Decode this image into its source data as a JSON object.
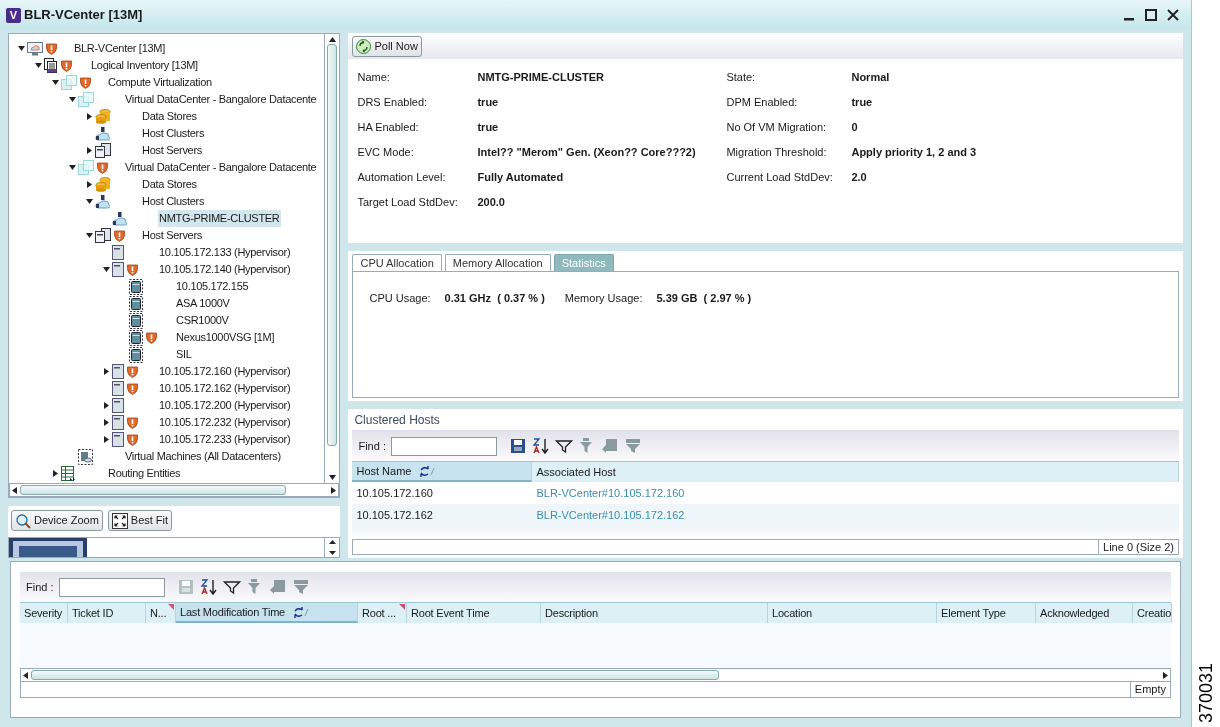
{
  "window": {
    "logo_letter": "V",
    "title": "BLR-VCenter [13M]"
  },
  "tree": [
    {
      "label": "BLR-VCenter [13M]",
      "kind": "vcenter",
      "alert": true,
      "expanded": true,
      "selected": false,
      "children": [
        {
          "label": "Logical Inventory [13M]",
          "kind": "inventory",
          "alert": true,
          "expanded": true,
          "selected": false,
          "children": [
            {
              "label": "Compute Virtualization",
              "kind": "compute",
              "alert": true,
              "expanded": true,
              "selected": false,
              "children": [
                {
                  "label": "Virtual DataCenter - Bangalore Datacente",
                  "kind": "compute",
                  "alert": false,
                  "expanded": true,
                  "selected": false,
                  "children": [
                    {
                      "label": "Data Stores",
                      "kind": "datastore",
                      "alert": false,
                      "expanded": false,
                      "selected": false
                    },
                    {
                      "label": "Host Clusters",
                      "kind": "cluster",
                      "alert": false,
                      "selected": false
                    },
                    {
                      "label": "Host Servers",
                      "kind": "servers",
                      "alert": false,
                      "expanded": false,
                      "selected": false
                    }
                  ]
                },
                {
                  "label": "Virtual DataCenter - Bangalore Datacente",
                  "kind": "compute",
                  "alert": true,
                  "expanded": true,
                  "selected": false,
                  "children": [
                    {
                      "label": "Data Stores",
                      "kind": "datastore",
                      "alert": false,
                      "expanded": false,
                      "selected": false
                    },
                    {
                      "label": "Host Clusters",
                      "kind": "cluster",
                      "alert": false,
                      "expanded": true,
                      "selected": false,
                      "children": [
                        {
                          "label": "NMTG-PRIME-CLUSTER",
                          "kind": "cluster",
                          "alert": false,
                          "selected": true
                        }
                      ]
                    },
                    {
                      "label": "Host Servers",
                      "kind": "servers",
                      "alert": true,
                      "expanded": true,
                      "selected": false,
                      "children": [
                        {
                          "label": "10.105.172.133 (Hypervisor)",
                          "kind": "server",
                          "alert": false,
                          "selected": false
                        },
                        {
                          "label": "10.105.172.140 (Hypervisor)",
                          "kind": "server",
                          "alert": true,
                          "expanded": true,
                          "selected": false,
                          "children": [
                            {
                              "label": "10.105.172.155",
                              "kind": "vm",
                              "alert": false,
                              "selected": false
                            },
                            {
                              "label": "ASA 1000V",
                              "kind": "vm",
                              "alert": false,
                              "selected": false
                            },
                            {
                              "label": "CSR1000V",
                              "kind": "vm",
                              "alert": false,
                              "selected": false
                            },
                            {
                              "label": "Nexus1000VSG [1M]",
                              "kind": "vm",
                              "alert": true,
                              "selected": false
                            },
                            {
                              "label": "SIL",
                              "kind": "vm",
                              "alert": false,
                              "selected": false
                            }
                          ]
                        },
                        {
                          "label": "10.105.172.160 (Hypervisor)",
                          "kind": "server",
                          "alert": true,
                          "expanded": false,
                          "selected": false
                        },
                        {
                          "label": "10.105.172.162 (Hypervisor)",
                          "kind": "server",
                          "alert": true,
                          "selected": false
                        },
                        {
                          "label": "10.105.172.200 (Hypervisor)",
                          "kind": "server",
                          "alert": false,
                          "expanded": false,
                          "selected": false
                        },
                        {
                          "label": "10.105.172.232 (Hypervisor)",
                          "kind": "server",
                          "alert": true,
                          "expanded": false,
                          "selected": false
                        },
                        {
                          "label": "10.105.172.233 (Hypervisor)",
                          "kind": "server",
                          "alert": true,
                          "expanded": false,
                          "selected": false
                        }
                      ]
                    }
                  ]
                },
                {
                  "label": "Virtual Machines (All Datacenters)",
                  "kind": "vms",
                  "alert": false,
                  "selected": false
                }
              ]
            },
            {
              "label": "Routing Entities",
              "kind": "routing",
              "alert": false,
              "expanded": false,
              "selected": false
            }
          ]
        }
      ]
    }
  ],
  "zoom_buttons": [
    {
      "label": "Device Zoom",
      "kind": "zoom"
    },
    {
      "label": "Best Fit",
      "kind": "fit"
    }
  ],
  "poll_button": "Poll Now",
  "properties_left": [
    {
      "label": "Name:",
      "value": "NMTG-PRIME-CLUSTER"
    },
    {
      "label": "DRS Enabled:",
      "value": "true"
    },
    {
      "label": "HA Enabled:",
      "value": "true"
    },
    {
      "label": "EVC Mode:",
      "value": "Intel?? \"Merom\" Gen. (Xeon?? Core???2)"
    },
    {
      "label": "Automation Level:",
      "value": "Fully Automated"
    },
    {
      "label": "Target Load StdDev:",
      "value": "200.0"
    }
  ],
  "properties_right": [
    {
      "label": "State:",
      "value": "Normal"
    },
    {
      "label": "DPM Enabled:",
      "value": "true"
    },
    {
      "label": "No Of VM Migration:",
      "value": "0"
    },
    {
      "label": "Migration Threshold:",
      "value": "Apply priority 1, 2 and 3"
    },
    {
      "label": "Current Load StdDev:",
      "value": "2.0"
    }
  ],
  "tabs": [
    {
      "label": "CPU Allocation",
      "selected": false
    },
    {
      "label": "Memory Allocation",
      "selected": false
    },
    {
      "label": "Statistics",
      "selected": true
    }
  ],
  "statistics": [
    {
      "label": "CPU Usage:",
      "value": "0.31 GHz  ( 0.37 % )"
    },
    {
      "label": "Memory Usage:",
      "value": "5.39 GB  ( 2.97 % )"
    }
  ],
  "clustered_hosts": {
    "title": "Clustered Hosts",
    "find_label": "Find :",
    "toolbar": [
      {
        "kind": "save",
        "disabled": false
      },
      {
        "kind": "sort",
        "disabled": false
      },
      {
        "kind": "filter",
        "disabled": false
      },
      {
        "kind": "clear-filter",
        "disabled": true
      },
      {
        "kind": "back",
        "disabled": true
      },
      {
        "kind": "edit-filter",
        "disabled": true
      }
    ],
    "columns": [
      {
        "label": "Host Name",
        "sorted": true,
        "marked": false
      },
      {
        "label": "Associated Host",
        "sorted": false,
        "marked": false
      }
    ],
    "rows": [
      [
        "10.105.172.160",
        "BLR-VCenter#10.105.172.160"
      ],
      [
        "10.105.172.162",
        "BLR-VCenter#10.105.172.162"
      ]
    ],
    "status": "Line 0 (Size 2)"
  },
  "tickets": {
    "find_label": "Find :",
    "toolbar": [
      {
        "kind": "save",
        "disabled": true
      },
      {
        "kind": "sort",
        "disabled": false
      },
      {
        "kind": "filter",
        "disabled": false
      },
      {
        "kind": "clear-filter",
        "disabled": true
      },
      {
        "kind": "back",
        "disabled": true
      },
      {
        "kind": "edit-filter",
        "disabled": true
      }
    ],
    "columns": [
      {
        "label": "Severity",
        "sorted": false,
        "marked": false
      },
      {
        "label": "Ticket ID",
        "sorted": false,
        "marked": false
      },
      {
        "label": "N...",
        "sorted": false,
        "marked": true
      },
      {
        "label": "Last Modification Time",
        "sorted": true,
        "marked": false
      },
      {
        "label": "Root ...",
        "sorted": false,
        "marked": true
      },
      {
        "label": "Root Event Time",
        "sorted": false,
        "marked": false
      },
      {
        "label": "Description",
        "sorted": false,
        "marked": false
      },
      {
        "label": "Location",
        "sorted": false,
        "marked": false
      },
      {
        "label": "Element Type",
        "sorted": false,
        "marked": false
      },
      {
        "label": "Acknowledged",
        "sorted": false,
        "marked": false
      },
      {
        "label": "Creatio",
        "sorted": false,
        "marked": false
      }
    ],
    "status": "Empty"
  },
  "figure_id": "370031"
}
